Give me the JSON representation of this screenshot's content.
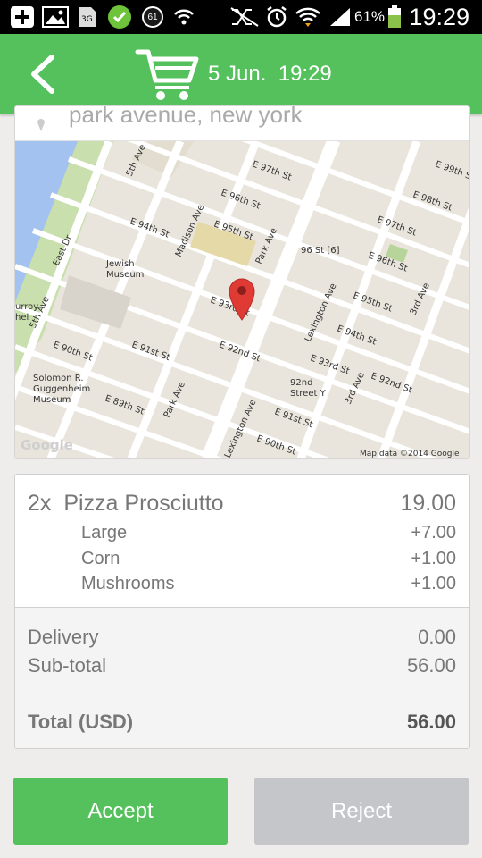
{
  "status": {
    "battery_percent": "61%",
    "time": "19:29",
    "notification_badge": "61"
  },
  "appbar": {
    "title": "5 Jun.  19:29"
  },
  "address": {
    "text": "park avenue, new york"
  },
  "map": {
    "labels": {
      "e97": "E 97th St",
      "e96": "E 96th St",
      "e95": "E 95th St",
      "e94": "E 94th St",
      "e93": "E 93rd St",
      "e92": "E 92nd St",
      "e91": "E 91st St",
      "e90": "E 90th St",
      "e89": "E 89th St",
      "e99": "E 99th St",
      "e98": "E 98th St",
      "fifth": "5th Ave",
      "madison": "Madison Ave",
      "park": "Park Ave",
      "lex": "Lexington Ave",
      "third": "3rd Ave",
      "eastdr": "East Dr",
      "jewish": "Jewish\nMuseum",
      "guggenheim": "Solomon R.\nGuggenheim\nMuseum",
      "station": "96 St [6]",
      "y92": "92nd\nStreet Y",
      "urroy": "urroy\nhel",
      "credit": "Map data ©2014 Google",
      "logo": "Google"
    }
  },
  "order": {
    "item": {
      "qty": "2x",
      "name": "Pizza Prosciutto",
      "price": "19.00"
    },
    "options": [
      {
        "name": "Large",
        "price": "+7.00"
      },
      {
        "name": "Corn",
        "price": "+1.00"
      },
      {
        "name": "Mushrooms",
        "price": "+1.00"
      }
    ],
    "delivery": {
      "label": "Delivery",
      "value": "0.00"
    },
    "subtotal": {
      "label": "Sub-total",
      "value": "56.00"
    },
    "total": {
      "label": "Total (USD)",
      "value": "56.00"
    }
  },
  "actions": {
    "accept": "Accept",
    "reject": "Reject"
  },
  "colors": {
    "brand_green": "#55c15c",
    "reject_gray": "#c4c6ca",
    "map_pin": "#e03a35"
  }
}
